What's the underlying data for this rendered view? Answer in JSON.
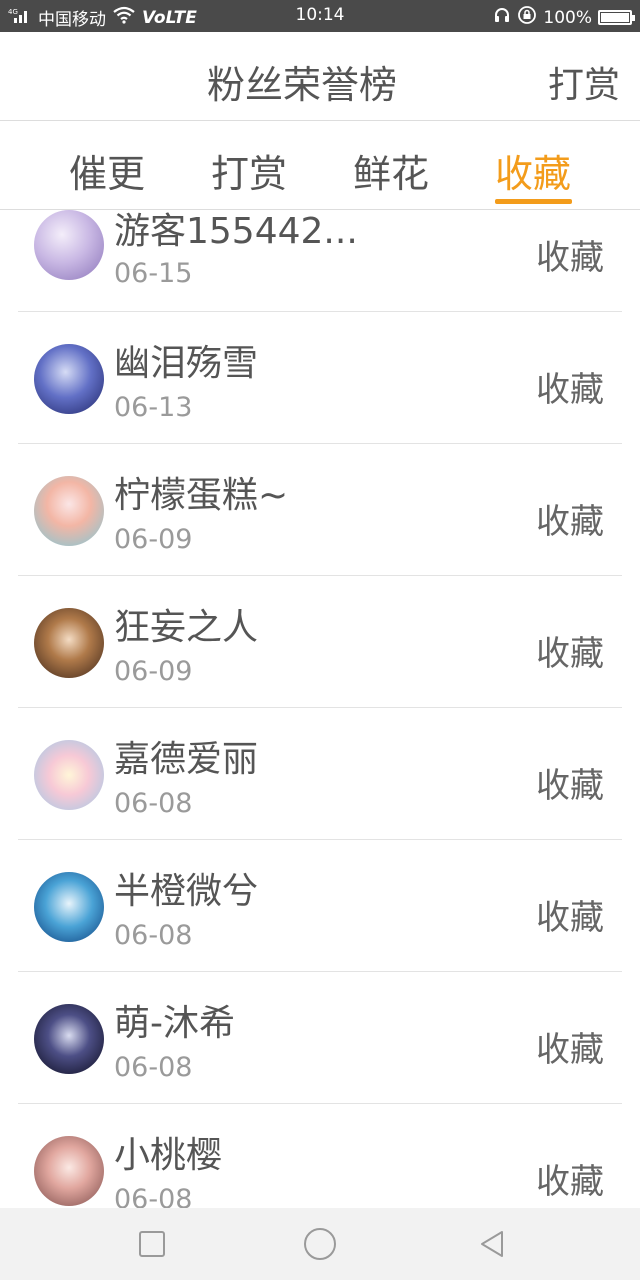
{
  "status_bar": {
    "net": "4G",
    "carrier": "中国移动",
    "volte": "VoLTE",
    "time": "10:14",
    "battery": "100%",
    "battery_level": 1.0
  },
  "header": {
    "title": "粉丝荣誉榜",
    "reward_label": "打赏"
  },
  "tabs": [
    {
      "label": "催更",
      "active": false
    },
    {
      "label": "打赏",
      "active": false
    },
    {
      "label": "鲜花",
      "active": false
    },
    {
      "label": "收藏",
      "active": true
    }
  ],
  "colors": {
    "accent": "#f39c1b",
    "status_bar": "#4a4a4a"
  },
  "fans": [
    {
      "name": "游客155442...",
      "date": "06-15",
      "action": "收藏"
    },
    {
      "name": "幽泪殇雪",
      "date": "06-13",
      "action": "收藏"
    },
    {
      "name": "柠檬蛋糕~",
      "date": "06-09",
      "action": "收藏"
    },
    {
      "name": "狂妄之人",
      "date": "06-09",
      "action": "收藏"
    },
    {
      "name": "嘉德爱丽",
      "date": "06-08",
      "action": "收藏"
    },
    {
      "name": "半橙微兮",
      "date": "06-08",
      "action": "收藏"
    },
    {
      "name": "萌-沐希",
      "date": "06-08",
      "action": "收藏"
    },
    {
      "name": "小桃樱",
      "date": "06-08",
      "action": "收藏"
    }
  ],
  "nav": {
    "recent_icon": "square-icon",
    "home_icon": "circle-icon",
    "back_icon": "triangle-back-icon"
  }
}
